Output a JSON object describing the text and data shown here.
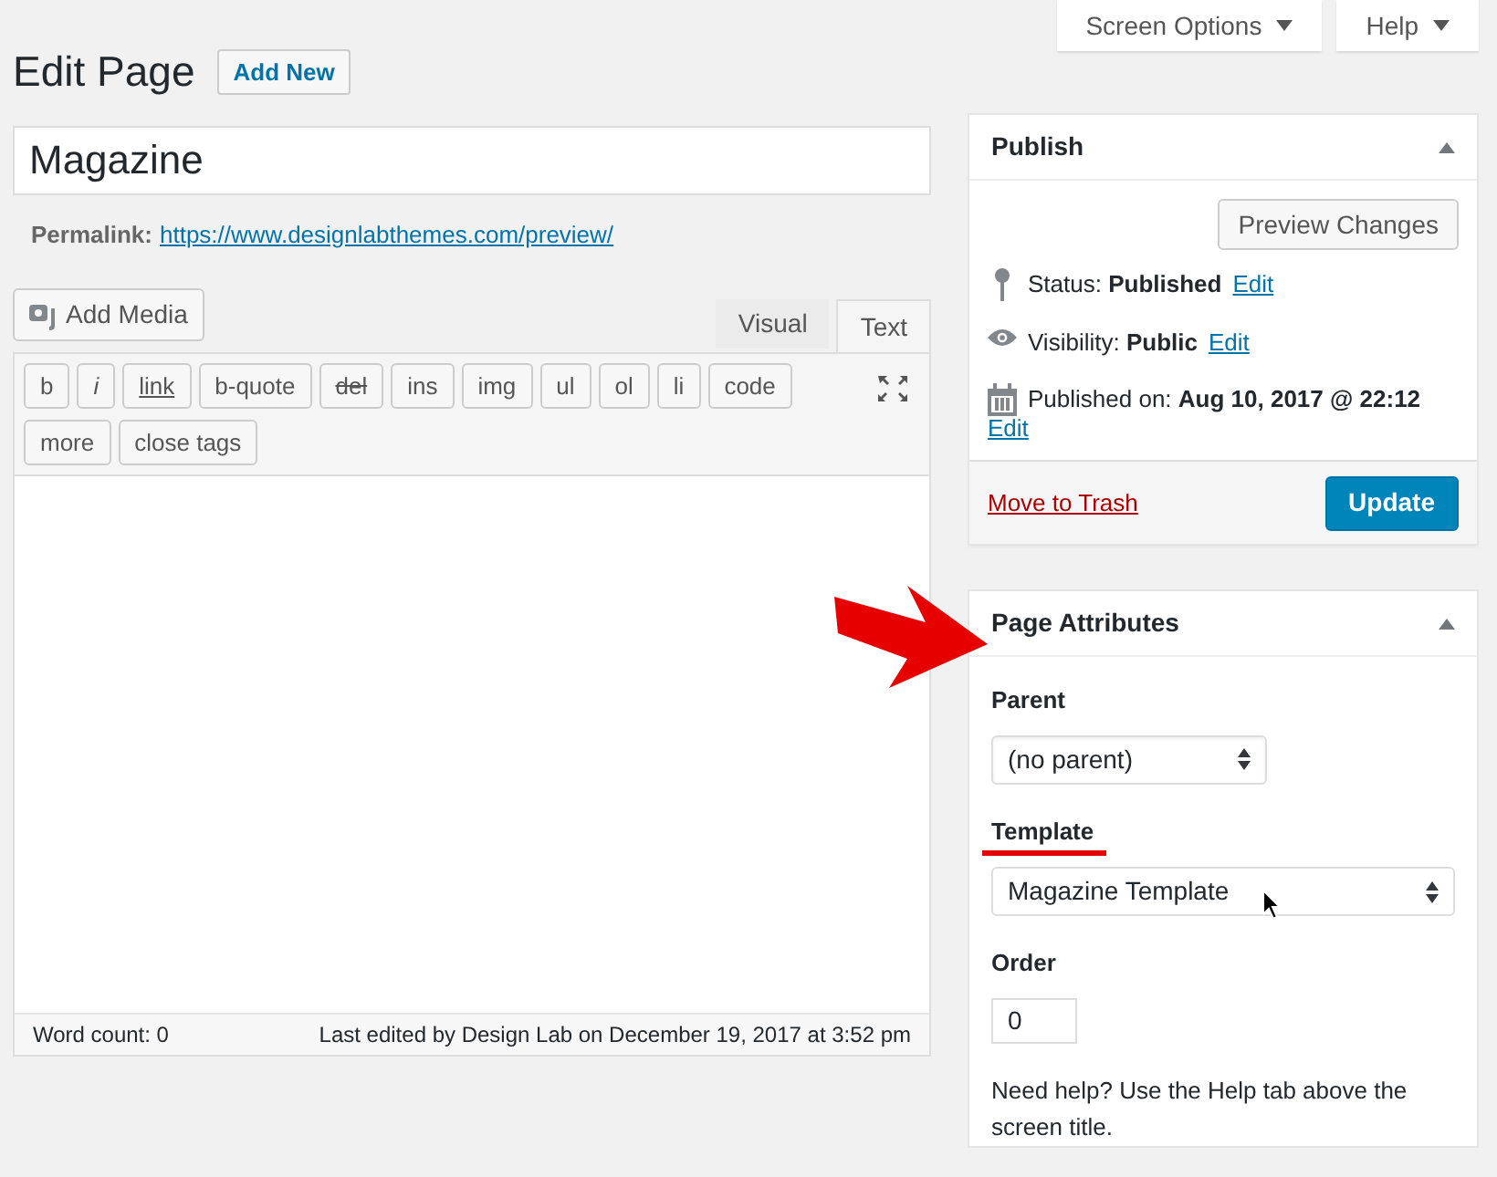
{
  "top_buttons": [
    {
      "label": "Screen Options"
    },
    {
      "label": "Help"
    }
  ],
  "heading": {
    "title": "Edit Page",
    "add_new": "Add New"
  },
  "post_title": "Magazine",
  "permalink": {
    "label": "Permalink:",
    "url": "https://www.designlabthemes.com/preview/"
  },
  "editor": {
    "add_media": "Add Media",
    "tabs": [
      {
        "label": "Visual",
        "selected": false
      },
      {
        "label": "Text",
        "selected": true
      }
    ],
    "toolbar": [
      {
        "label": "b",
        "kind": "plain"
      },
      {
        "label": "i",
        "kind": "italic"
      },
      {
        "label": "link",
        "kind": "underline"
      },
      {
        "label": "b-quote",
        "kind": "plain"
      },
      {
        "label": "del",
        "kind": "strike"
      },
      {
        "label": "ins",
        "kind": "plain"
      },
      {
        "label": "img",
        "kind": "plain"
      },
      {
        "label": "ul",
        "kind": "plain"
      },
      {
        "label": "ol",
        "kind": "plain"
      },
      {
        "label": "li",
        "kind": "plain"
      },
      {
        "label": "code",
        "kind": "plain"
      },
      {
        "label": "more",
        "kind": "plain"
      },
      {
        "label": "close tags",
        "kind": "plain"
      }
    ],
    "word_count": "Word count: 0",
    "last_edited": "Last edited by Design Lab on December 19, 2017 at 3:52 pm"
  },
  "publish": {
    "title": "Publish",
    "preview": "Preview Changes",
    "rows": [
      {
        "kind": "status",
        "label": "Status:",
        "value": "Published",
        "link": "Edit"
      },
      {
        "kind": "visibility",
        "label": "Visibility:",
        "value": "Public",
        "link": "Edit"
      },
      {
        "kind": "date",
        "label": "Published on:",
        "value": "Aug 10, 2017 @ 22:12",
        "link": "Edit"
      }
    ],
    "trash": "Move to Trash",
    "update": "Update"
  },
  "page_attributes": {
    "title": "Page Attributes",
    "parent_label": "Parent",
    "parent_value": "(no parent)",
    "template_label": "Template",
    "template_value": "Magazine Template",
    "order_label": "Order",
    "order_value": "0",
    "help": "Need help? Use the Help tab above the screen title."
  }
}
